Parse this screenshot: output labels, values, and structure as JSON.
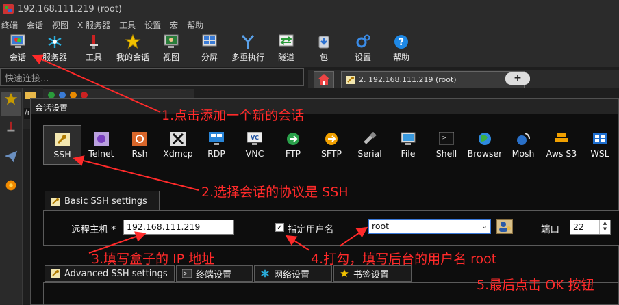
{
  "window": {
    "title": "192.168.111.219 (root)"
  },
  "menu": [
    "终端",
    "会话",
    "视图",
    "X 服务器",
    "工具",
    "设置",
    "宏",
    "帮助"
  ],
  "toolbar": [
    {
      "label": "会话",
      "icon": "monitor-icon"
    },
    {
      "label": "服务器",
      "icon": "servers-icon"
    },
    {
      "label": "工具",
      "icon": "tools-icon"
    },
    {
      "label": "我的会话",
      "icon": "star-icon"
    },
    {
      "label": "视图",
      "icon": "view-icon"
    },
    {
      "label": "分屏",
      "icon": "split-icon"
    },
    {
      "label": "多重执行",
      "icon": "multiexec-icon"
    },
    {
      "label": "隧道",
      "icon": "tunnel-icon"
    },
    {
      "label": "包",
      "icon": "package-icon"
    },
    {
      "label": "设置",
      "icon": "gear-icon"
    },
    {
      "label": "帮助",
      "icon": "help-icon"
    }
  ],
  "quick_connect": {
    "placeholder": "快速连接..."
  },
  "tab": {
    "label": "2. 192.168.111.219 (root)"
  },
  "side_path": "/ro",
  "dialog": {
    "title": "会话设置",
    "protocols": [
      {
        "label": "SSH",
        "icon": "ssh-key-icon",
        "selected": true
      },
      {
        "label": "Telnet",
        "icon": "telnet-icon"
      },
      {
        "label": "Rsh",
        "icon": "rsh-icon"
      },
      {
        "label": "Xdmcp",
        "icon": "x-icon"
      },
      {
        "label": "RDP",
        "icon": "rdp-icon"
      },
      {
        "label": "VNC",
        "icon": "vnc-icon"
      },
      {
        "label": "FTP",
        "icon": "ftp-icon"
      },
      {
        "label": "SFTP",
        "icon": "sftp-icon"
      },
      {
        "label": "Serial",
        "icon": "serial-icon"
      },
      {
        "label": "File",
        "icon": "file-icon"
      },
      {
        "label": "Shell",
        "icon": "shell-icon"
      },
      {
        "label": "Browser",
        "icon": "browser-icon"
      },
      {
        "label": "Mosh",
        "icon": "mosh-icon"
      },
      {
        "label": "Aws S3",
        "icon": "aws-icon"
      },
      {
        "label": "WSL",
        "icon": "wsl-icon"
      }
    ],
    "basic_tab": "Basic SSH settings",
    "remote_host_label": "远程主机 *",
    "remote_host_value": "192.168.111.219",
    "specify_user_label": "指定用户名",
    "specify_user_checked": true,
    "username_value": "root",
    "port_label": "端口",
    "port_value": "22",
    "lower_tabs": [
      "Advanced SSH settings",
      "终端设置",
      "网络设置",
      "书签设置"
    ]
  },
  "annotations": [
    "1.点击添加一个新的会话",
    "2.选择会话的协议是 SSH",
    "3.填写盒子的 IP 地址",
    "4.打勾，填写后台的用户名 root",
    "5.最后点击 OK 按钮"
  ],
  "colors": {
    "annotation": "#ff2a2a",
    "dialog_bg": "#0d0d0d",
    "toolbar_bg": "#2b2b2b"
  }
}
